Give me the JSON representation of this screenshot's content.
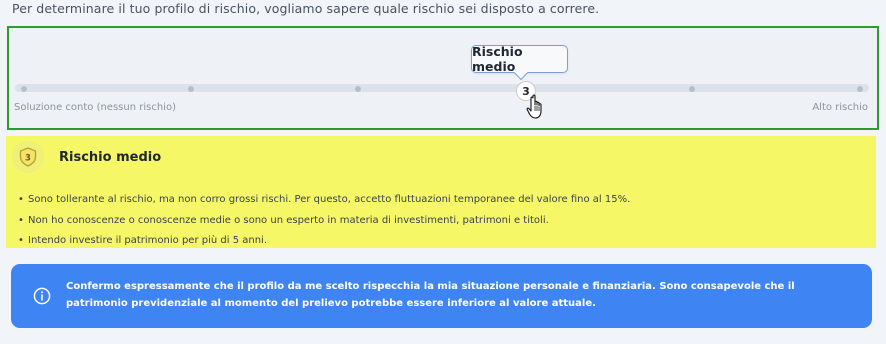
{
  "intro": {
    "text": "Per determinare il tuo profilo di rischio, vogliamo sapere quale rischio sei disposto a correre."
  },
  "slider": {
    "tooltip": "Rischio medio",
    "value": "3",
    "min_label": "Soluzione conto (nessun rischio)",
    "max_label": "Alto rischio"
  },
  "risk_card": {
    "badge_number": "3",
    "title": "Rischio medio",
    "bullets": [
      "Sono tollerante al rischio, ma non corro grossi rischi. Per questo, accetto fluttuazioni temporanee del valore fino al 15%.",
      "Non ho conoscenze o conoscenze medie o sono un esperto in materia di investimenti, patrimoni e titoli.",
      "Intendo investire il patrimonio per più di 5 anni."
    ]
  },
  "confirm": {
    "text": "Confermo espressamente che il profilo da me scelto rispecchia la mia situazione personale e finanziaria. Sono consapevole che il patrimonio previdenziale al momento del prelievo potrebbe essere inferiore al valore attuale."
  },
  "colors": {
    "slider_border": "#2e9a35",
    "risk_card_bg": "#f5f766",
    "confirm_bg": "#3e84f2"
  }
}
